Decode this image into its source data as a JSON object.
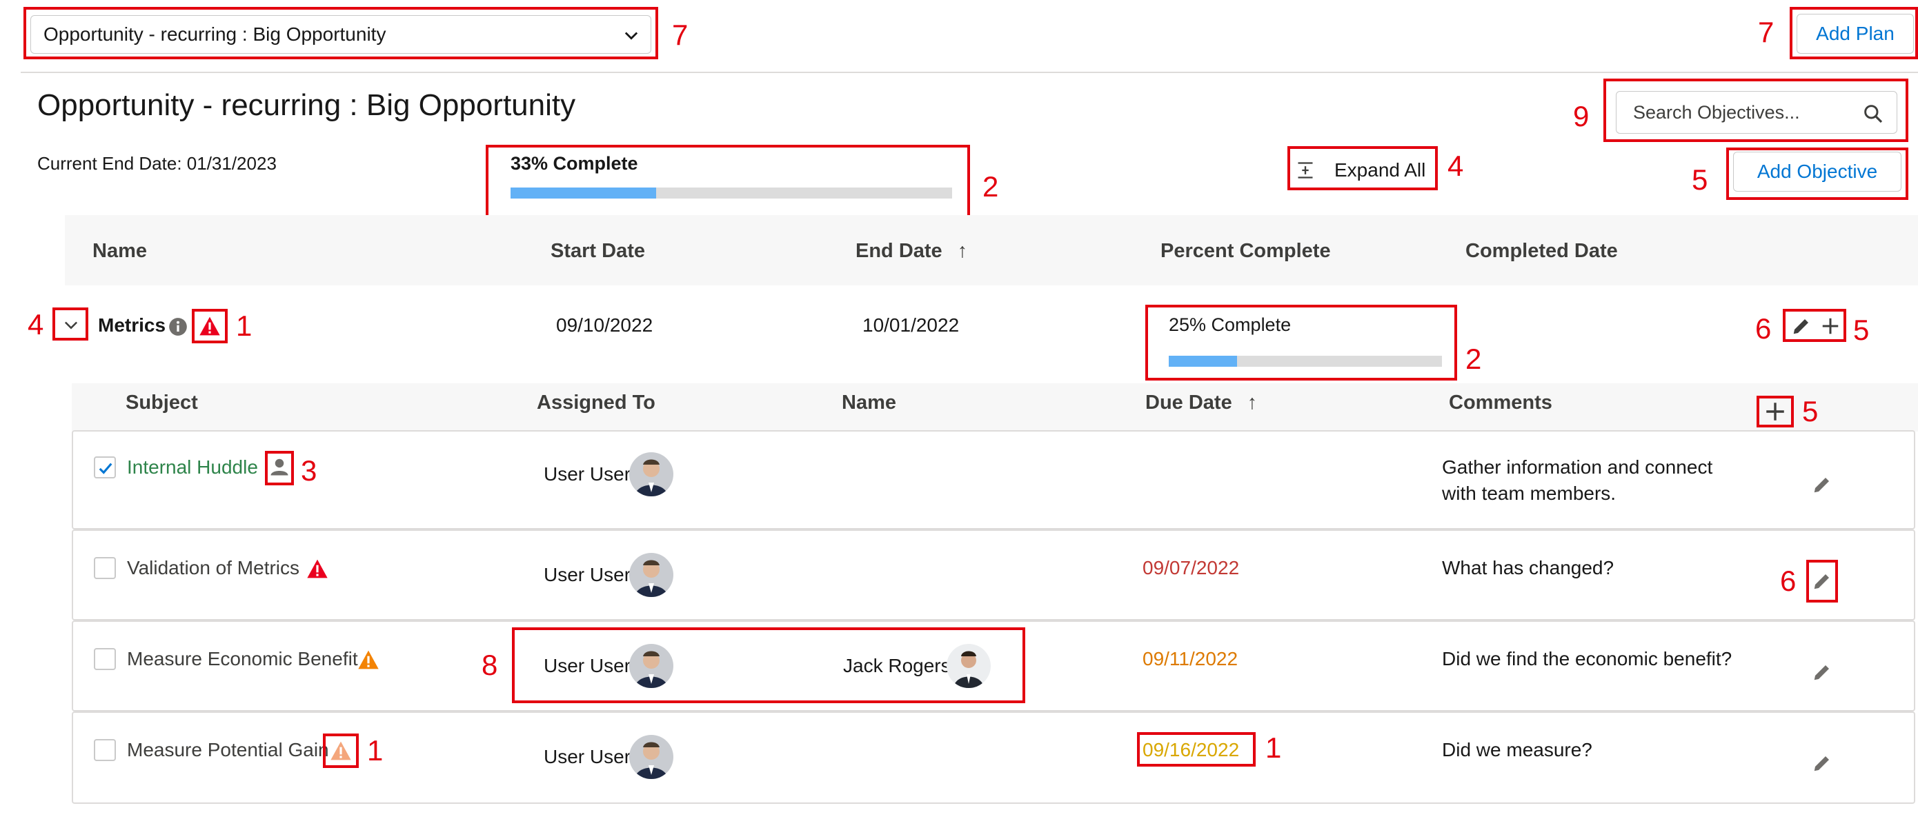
{
  "plan_picker": {
    "value": "Opportunity - recurring : Big Opportunity"
  },
  "header": {
    "add_plan_label": "Add Plan",
    "title": "Opportunity - recurring : Big Opportunity",
    "end_date_label": "Current End Date: 01/31/2023",
    "progress_label": "33% Complete",
    "progress_fraction": 0.33,
    "expand_all_label": "Expand All",
    "search_placeholder": "Search Objectives...",
    "add_objective_label": "Add Objective"
  },
  "objective_table": {
    "columns": [
      "Name",
      "Start Date",
      "End Date",
      "Percent Complete",
      "Completed Date"
    ],
    "sort_arrow": "↑"
  },
  "objective": {
    "name": "Metrics",
    "start_date": "09/10/2022",
    "end_date": "10/01/2022",
    "progress_label": "25% Complete",
    "progress_fraction": 0.25
  },
  "action_table": {
    "columns": [
      "Subject",
      "Assigned To",
      "Name",
      "Due Date",
      "Comments"
    ],
    "rows": [
      {
        "subject": "Internal Huddle",
        "checked": true,
        "assigned_to": "User User",
        "name": "",
        "due_date": "",
        "comments_line1": "Gather information and connect",
        "comments_line2": "with team members."
      },
      {
        "subject": "Validation of Metrics",
        "checked": false,
        "assigned_to": "User User",
        "name": "",
        "due_date": "09/07/2022",
        "comments_line1": "What has changed?",
        "comments_line2": ""
      },
      {
        "subject": "Measure Economic Benefit",
        "checked": false,
        "assigned_to": "User User",
        "name": "Jack Rogers",
        "due_date": "09/11/2022",
        "comments_line1": "Did we find the economic benefit?",
        "comments_line2": ""
      },
      {
        "subject": "Measure Potential Gain",
        "checked": false,
        "assigned_to": "User User",
        "name": "",
        "due_date": "09/16/2022",
        "comments_line1": "Did we measure?",
        "comments_line2": ""
      }
    ]
  },
  "annotations": {
    "n1": "1",
    "n2": "2",
    "n3": "3",
    "n4": "4",
    "n5": "5",
    "n6": "6",
    "n7": "7",
    "n8": "8",
    "n9": "9"
  },
  "colors": {
    "link": "#0176d3",
    "complete_text": "#2e844a",
    "overdue": "#c23934",
    "due_soon": "#dd7a01",
    "due_later": "#d9a700",
    "annotation_red": "#e3000f",
    "progress_fill": "#62b1f6"
  }
}
